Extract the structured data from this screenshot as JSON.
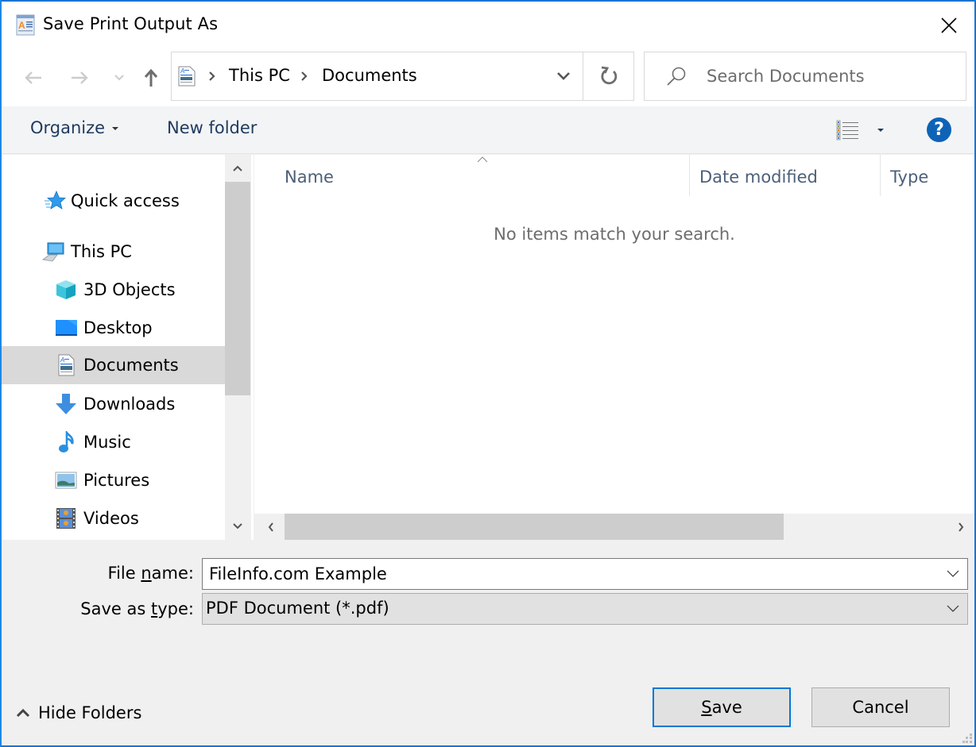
{
  "window": {
    "title": "Save Print Output As",
    "accent_color": "#0078d7"
  },
  "nav": {
    "back_icon": "arrow-left-icon",
    "forward_icon": "arrow-right-icon",
    "recent_icon": "chevron-down-icon",
    "up_icon": "arrow-up-icon",
    "breadcrumbs": [
      "This PC",
      "Documents"
    ],
    "refresh_icon": "refresh-icon"
  },
  "search": {
    "placeholder": "Search Documents",
    "value": ""
  },
  "toolbar": {
    "organize_label": "Organize",
    "new_folder_label": "New folder",
    "help_label": "?"
  },
  "sidebar": {
    "items": [
      {
        "label": "Quick access",
        "icon": "star-icon",
        "level": 0
      },
      {
        "label": "This PC",
        "icon": "computer-icon",
        "level": 0
      },
      {
        "label": "3D Objects",
        "icon": "cube-icon",
        "level": 1
      },
      {
        "label": "Desktop",
        "icon": "desktop-icon",
        "level": 1
      },
      {
        "label": "Documents",
        "icon": "document-icon",
        "level": 1,
        "selected": true
      },
      {
        "label": "Downloads",
        "icon": "download-arrow-icon",
        "level": 1
      },
      {
        "label": "Music",
        "icon": "music-note-icon",
        "level": 1
      },
      {
        "label": "Pictures",
        "icon": "picture-icon",
        "level": 1
      },
      {
        "label": "Videos",
        "icon": "film-icon",
        "level": 1
      }
    ]
  },
  "filelist": {
    "columns": [
      "Name",
      "Date modified",
      "Type"
    ],
    "sorted_by": "Name",
    "empty_message": "No items match your search."
  },
  "form": {
    "file_name_label_pre": "File ",
    "file_name_label_key": "n",
    "file_name_label_post": "ame:",
    "file_name_value": "FileInfo.com Example",
    "save_type_label_pre": "Save as ",
    "save_type_label_key": "t",
    "save_type_label_post": "ype:",
    "save_type_value": "PDF Document (*.pdf)"
  },
  "footer": {
    "hide_folders_label": "Hide Folders",
    "save_key": "S",
    "save_rest": "ave",
    "cancel_label": "Cancel"
  }
}
